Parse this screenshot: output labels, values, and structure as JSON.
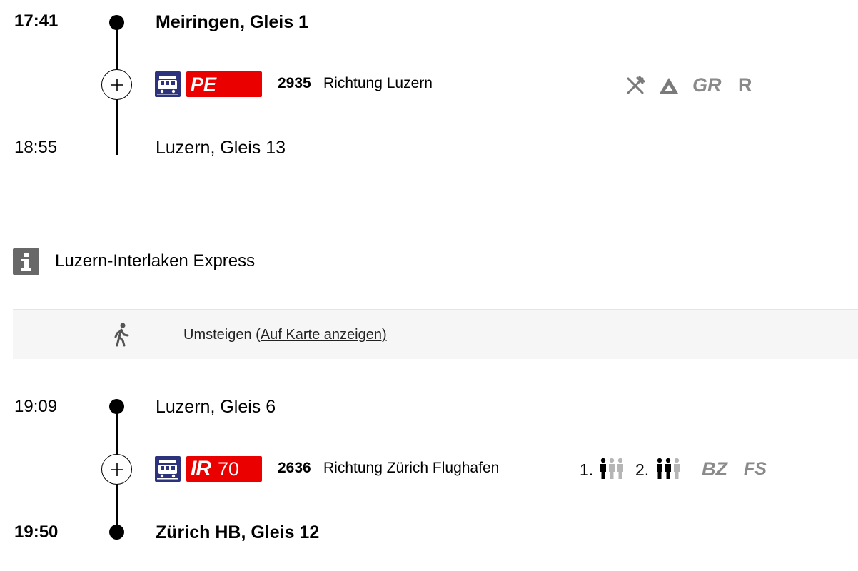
{
  "leg1": {
    "dep_time": "17:41",
    "dep_station": "Meiringen, Gleis 1",
    "product": "PE",
    "train_number": "2935",
    "direction": "Richtung Luzern",
    "attributes": [
      "restaurant-icon",
      "panorama-icon",
      "GR",
      "R"
    ],
    "attr_gr": "GR",
    "attr_r": "R",
    "arr_time": "18:55",
    "arr_station": "Luzern, Gleis 13"
  },
  "info": {
    "text": "Luzern-Interlaken Express"
  },
  "transfer": {
    "label": "Umsteigen",
    "link": "(Auf Karte anzeigen)"
  },
  "leg2": {
    "dep_time": "19:09",
    "dep_station": "Luzern, Gleis 6",
    "product": "IR",
    "line": "70",
    "train_number": "2636",
    "direction": "Richtung Zürich Flughafen",
    "occupancy": [
      {
        "class": "1.",
        "level": 1,
        "max": 3
      },
      {
        "class": "2.",
        "level": 2,
        "max": 3
      }
    ],
    "occ1_label": "1.",
    "occ2_label": "2.",
    "attr_bz": "BZ",
    "attr_fs": "FS",
    "arr_time": "19:50",
    "arr_station": "Zürich HB, Gleis 12"
  },
  "colors": {
    "train_icon_bg": "#2d327d",
    "product_badge": "#eb0000",
    "attribute_gray": "#8a8a8a",
    "info_icon_bg": "#686868",
    "transfer_bg": "#f6f6f6"
  }
}
